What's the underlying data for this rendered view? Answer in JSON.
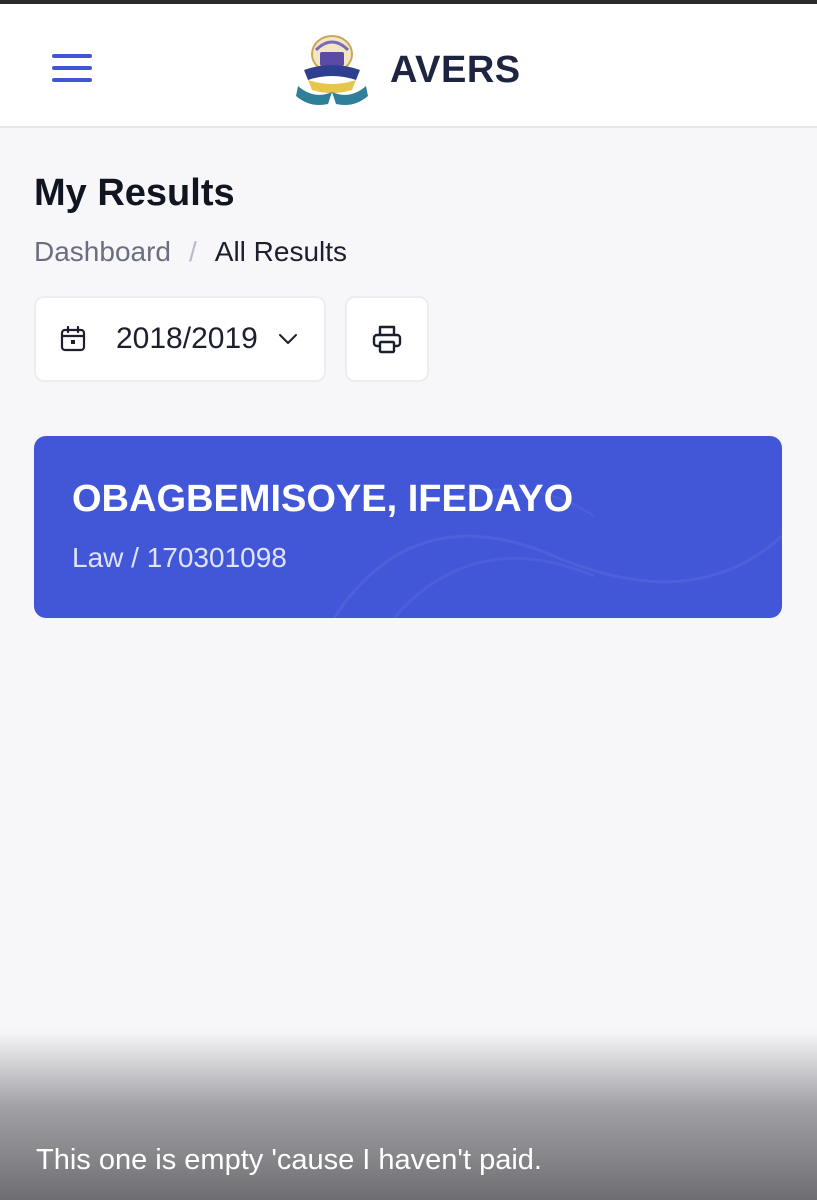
{
  "header": {
    "brand_name": "AVERS",
    "menu_icon": "hamburger-menu-icon",
    "logo_icon": "university-crest-logo"
  },
  "page": {
    "title": "My Results",
    "breadcrumb": {
      "link": "Dashboard",
      "separator": "/",
      "current": "All Results"
    }
  },
  "filters": {
    "session_icon": "calendar-icon",
    "session_value": "2018/2019",
    "dropdown_icon": "chevron-down-icon",
    "print_icon": "printer-icon"
  },
  "student": {
    "name": "OBAGBEMISOYE, IFEDAYO",
    "program_and_id": "Law / 170301098"
  },
  "caption": {
    "text": "This one is empty 'cause I haven't paid."
  },
  "colors": {
    "accent": "#4257d8",
    "menu_icon": "#3f55d6",
    "background": "#f7f7fa"
  }
}
